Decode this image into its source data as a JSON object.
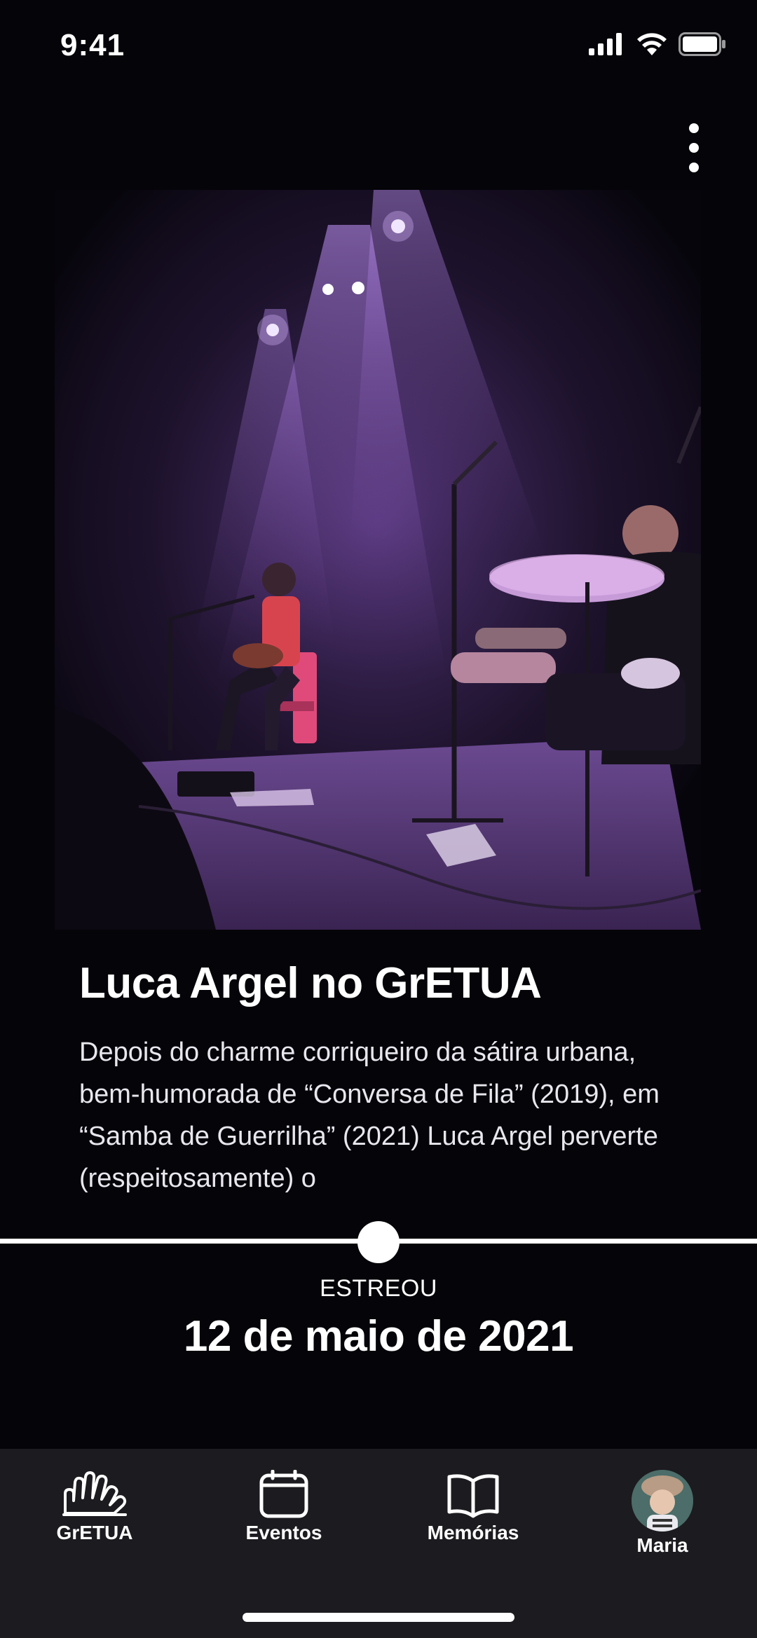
{
  "status": {
    "time": "9:41"
  },
  "event": {
    "title": "Luca Argel no GrETUA",
    "description": "Depois do charme corriqueiro da sátira urbana, bem-humorada de “Conversa de Fila” (2019), em “Samba de Guerrilha” (2021) Luca Argel perverte (respeitosamente) o"
  },
  "premiere": {
    "label": "ESTREOU",
    "date": "12 de maio de 2021"
  },
  "tabs": [
    {
      "label": "GrETUA",
      "icon": "gretua-hands-icon"
    },
    {
      "label": "Eventos",
      "icon": "calendar-icon"
    },
    {
      "label": "Memórias",
      "icon": "book-icon"
    },
    {
      "label": "Maria",
      "icon": "avatar"
    }
  ],
  "colors": {
    "background": "#050409",
    "tab_bar": "#1c1b1f",
    "accent": "#ffffff",
    "stage_light": "#a35ee0"
  }
}
